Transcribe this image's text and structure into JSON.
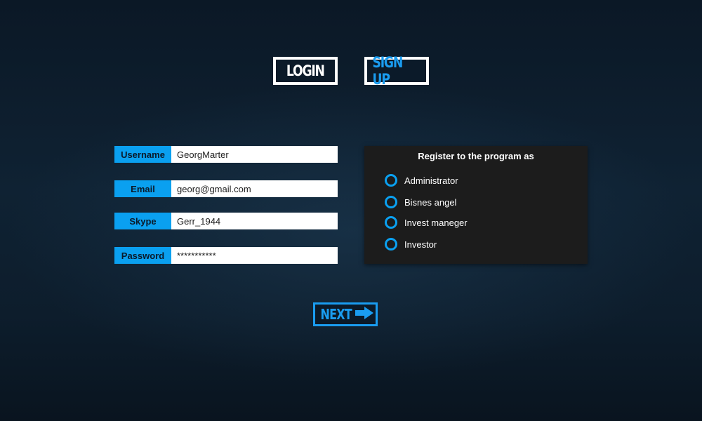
{
  "tabs": {
    "login_label": "LOGIN",
    "signup_label": "SIGN UP"
  },
  "form": {
    "username": {
      "label": "Username",
      "value": "GeorgMarter"
    },
    "email": {
      "label": "Email",
      "value": "georg@gmail.com"
    },
    "skype": {
      "label": "Skype",
      "value": "Gerr_1944"
    },
    "password": {
      "label": "Password",
      "value": "***********"
    }
  },
  "register": {
    "title": "Register to the program as",
    "options": [
      {
        "label": "Administrator"
      },
      {
        "label": "Bisnes angel"
      },
      {
        "label": "Invest maneger"
      },
      {
        "label": "Investor"
      }
    ]
  },
  "next_button": {
    "label": "NEXT",
    "icon": "arrow-right-icon"
  },
  "colors": {
    "accent": "#0aa0f0",
    "panel": "#1c1c1c",
    "background": "#0f2233"
  }
}
